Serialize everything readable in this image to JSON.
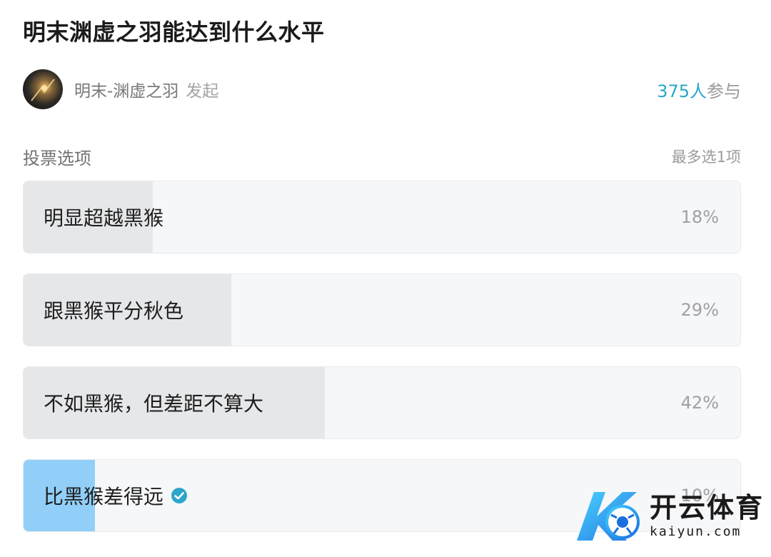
{
  "poll": {
    "title": "明末渊虚之羽能达到什么水平",
    "author": {
      "name": "明末-渊虚之羽",
      "action": "发起"
    },
    "participants": {
      "count": "375人",
      "suffix": "参与"
    },
    "section_title": "投票选项",
    "rule": "最多选1项",
    "options": [
      {
        "label": "明显超越黑猴",
        "percent_text": "18%",
        "percent": 18,
        "selected": false
      },
      {
        "label": "跟黑猴平分秋色",
        "percent_text": "29%",
        "percent": 29,
        "selected": false
      },
      {
        "label": "不如黑猴，但差距不算大",
        "percent_text": "42%",
        "percent": 42,
        "selected": false
      },
      {
        "label": "比黑猴差得远",
        "percent_text": "10%",
        "percent": 10,
        "selected": true
      }
    ]
  },
  "watermark": {
    "brand_cn": "开云体育",
    "brand_en": "kaiyun.com"
  },
  "colors": {
    "accent": "#2aa6c9",
    "selected_fill": "#91cff8",
    "bar_fill": "#e6e7e9",
    "bar_bg": "#f6f7f9"
  },
  "icons": {
    "selected_marker": "check-circle-icon",
    "avatar": "avatar-image"
  }
}
